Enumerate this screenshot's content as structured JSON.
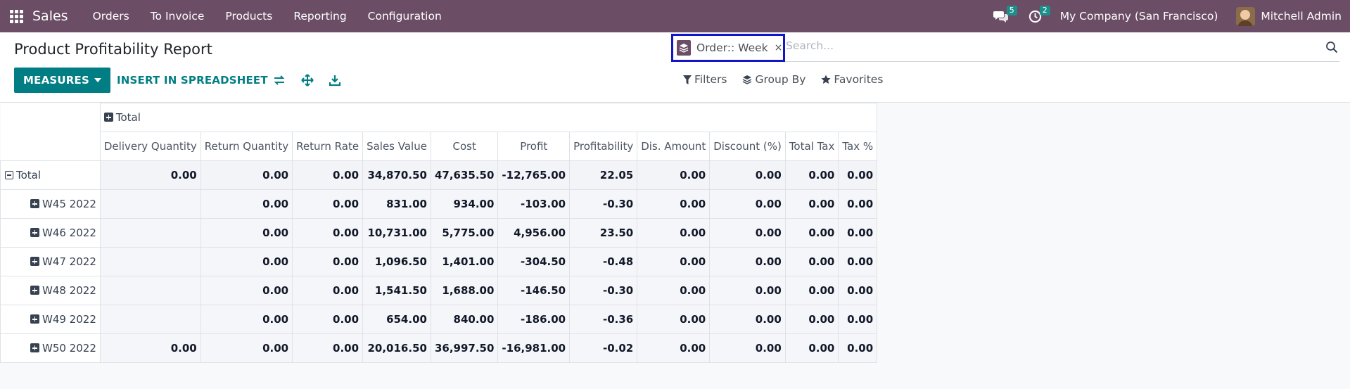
{
  "navbar": {
    "app_name": "Sales",
    "menu": [
      "Orders",
      "To Invoice",
      "Products",
      "Reporting",
      "Configuration"
    ],
    "messages_count": "5",
    "activities_count": "2",
    "company": "My Company (San Francisco)",
    "user": "Mitchell Admin"
  },
  "control_panel": {
    "title": "Product Profitability Report",
    "measures_label": "MEASURES",
    "insert_label": "INSERT IN SPREADSHEET",
    "facet_label": "Order:: Week",
    "facet_close": "×",
    "search_placeholder": "Search...",
    "filters_label": "Filters",
    "groupby_label": "Group By",
    "favorites_label": "Favorites"
  },
  "pivot": {
    "column_group": "Total",
    "measures": [
      "Delivery Quantity",
      "Return Quantity",
      "Return Rate",
      "Sales Value",
      "Cost",
      "Profit",
      "Profitability",
      "Dis. Amount",
      "Discount (%)",
      "Total Tax",
      "Tax %"
    ],
    "total_row": {
      "label": "Total",
      "values": [
        "0.00",
        "0.00",
        "0.00",
        "34,870.50",
        "47,635.50",
        "-12,765.00",
        "22.05",
        "0.00",
        "0.00",
        "0.00",
        "0.00"
      ]
    },
    "rows": [
      {
        "label": "W45 2022",
        "values": [
          "",
          "0.00",
          "0.00",
          "831.00",
          "934.00",
          "-103.00",
          "-0.30",
          "0.00",
          "0.00",
          "0.00",
          "0.00"
        ]
      },
      {
        "label": "W46 2022",
        "values": [
          "",
          "0.00",
          "0.00",
          "10,731.00",
          "5,775.00",
          "4,956.00",
          "23.50",
          "0.00",
          "0.00",
          "0.00",
          "0.00"
        ]
      },
      {
        "label": "W47 2022",
        "values": [
          "",
          "0.00",
          "0.00",
          "1,096.50",
          "1,401.00",
          "-304.50",
          "-0.48",
          "0.00",
          "0.00",
          "0.00",
          "0.00"
        ]
      },
      {
        "label": "W48 2022",
        "values": [
          "",
          "0.00",
          "0.00",
          "1,541.50",
          "1,688.00",
          "-146.50",
          "-0.30",
          "0.00",
          "0.00",
          "0.00",
          "0.00"
        ]
      },
      {
        "label": "W49 2022",
        "values": [
          "",
          "0.00",
          "0.00",
          "654.00",
          "840.00",
          "-186.00",
          "-0.36",
          "0.00",
          "0.00",
          "0.00",
          "0.00"
        ]
      },
      {
        "label": "W50 2022",
        "values": [
          "0.00",
          "0.00",
          "0.00",
          "20,016.50",
          "36,997.50",
          "-16,981.00",
          "-0.02",
          "0.00",
          "0.00",
          "0.00",
          "0.00"
        ]
      }
    ]
  }
}
